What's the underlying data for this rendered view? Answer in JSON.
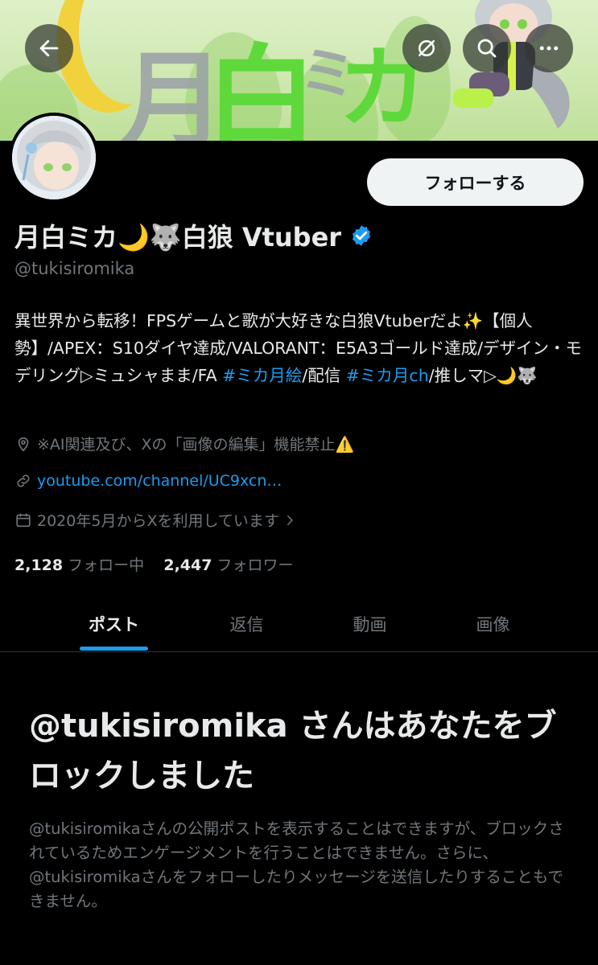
{
  "header": {
    "back_icon": "arrow-left-icon",
    "actions": [
      "translate-off-icon",
      "search-icon",
      "more-icon"
    ]
  },
  "banner": {
    "text_chars": [
      "月",
      "白",
      "ミ",
      "カ"
    ]
  },
  "profile": {
    "follow_label": "フォローする",
    "name_text": "月白ミカ🌙🐺白狼 Vtuber",
    "verified_icon": "verified-badge-icon",
    "handle": "@tukisiromika",
    "bio_part1": "異世界から転移！FPSゲームと歌が大好きな白狼Vtuberだよ✨【個人勢】/APEX：S10ダイヤ達成/VALORANT：E5A3ゴールド達成/デザイン・モデリング▷ミュシャまま/FA ",
    "bio_hashtag1": "#ミカ月絵",
    "bio_part2": "/配信 ",
    "bio_hashtag2": "#ミカ月ch",
    "bio_part3": "/推しマ▷🌙🐺",
    "location": "※AI関連及び、Xの「画像の編集」機能禁止⚠️",
    "website": "youtube.com/channel/UC9xcn…",
    "joined": "2020年5月からXを利用しています",
    "following_count": "2,128",
    "following_label": "フォロー中",
    "followers_count": "2,447",
    "followers_label": "フォロワー"
  },
  "tabs": [
    {
      "label": "ポスト",
      "active": true
    },
    {
      "label": "返信",
      "active": false
    },
    {
      "label": "動画",
      "active": false
    },
    {
      "label": "画像",
      "active": false
    }
  ],
  "blocked": {
    "title": "@tukisiromika さんはあなたをブロックしました",
    "body": "@tukisiromikaさんの公開ポストを表示することはできますが、ブロックされているためエンゲージメントを行うことはできません。さらに、@tukisiromikaさんをフォローしたりメッセージを送信したりすることもできません。"
  },
  "colors": {
    "accent": "#1d9bf0",
    "background": "#000000",
    "text_primary": "#e7e9ea",
    "text_secondary": "#71767b"
  }
}
